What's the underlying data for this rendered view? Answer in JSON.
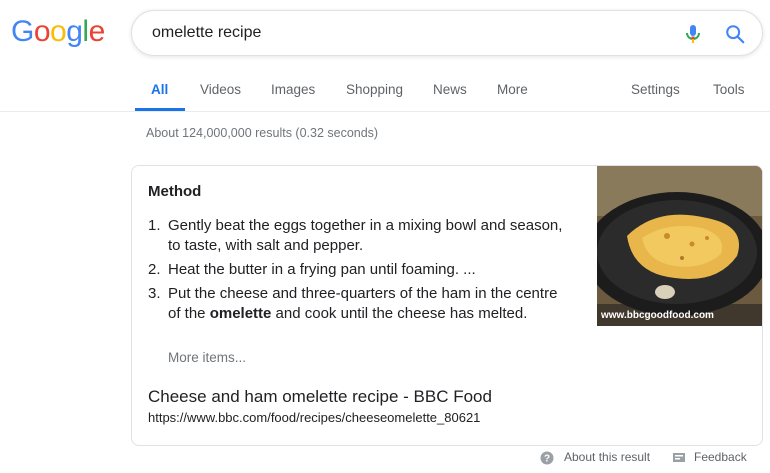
{
  "logo": {
    "letters": [
      "G",
      "o",
      "o",
      "g",
      "l",
      "e"
    ]
  },
  "search": {
    "query": "omelette recipe"
  },
  "tabs": [
    {
      "label": "All"
    },
    {
      "label": "Videos"
    },
    {
      "label": "Images"
    },
    {
      "label": "Shopping"
    },
    {
      "label": "News"
    },
    {
      "label": "More"
    }
  ],
  "tools": {
    "settings": "Settings",
    "tools": "Tools"
  },
  "stats": "About 124,000,000 results (0.32 seconds)",
  "snippet": {
    "heading": "Method",
    "steps": [
      {
        "num": "1.",
        "text": "Gently beat the eggs together in a mixing bowl and season, to taste, with salt and pepper."
      },
      {
        "num": "2.",
        "text": "Heat the butter in a frying pan until foaming. ..."
      },
      {
        "num": "3.",
        "text_before": "Put the cheese and three-quarters of the ham in the centre of the ",
        "text_bold": "omelette",
        "text_after": " and cook until the cheese has melted."
      }
    ],
    "more_items": "More items...",
    "image_caption": "www.bbcgoodfood.com",
    "result_title": "Cheese and ham omelette recipe - BBC Food",
    "result_url": "https://www.bbc.com/food/recipes/cheeseomelette_80621"
  },
  "footer": {
    "about": "About this result",
    "feedback": "Feedback"
  },
  "colors": {
    "accent": "#1a73e8",
    "muted": "#70757a"
  }
}
